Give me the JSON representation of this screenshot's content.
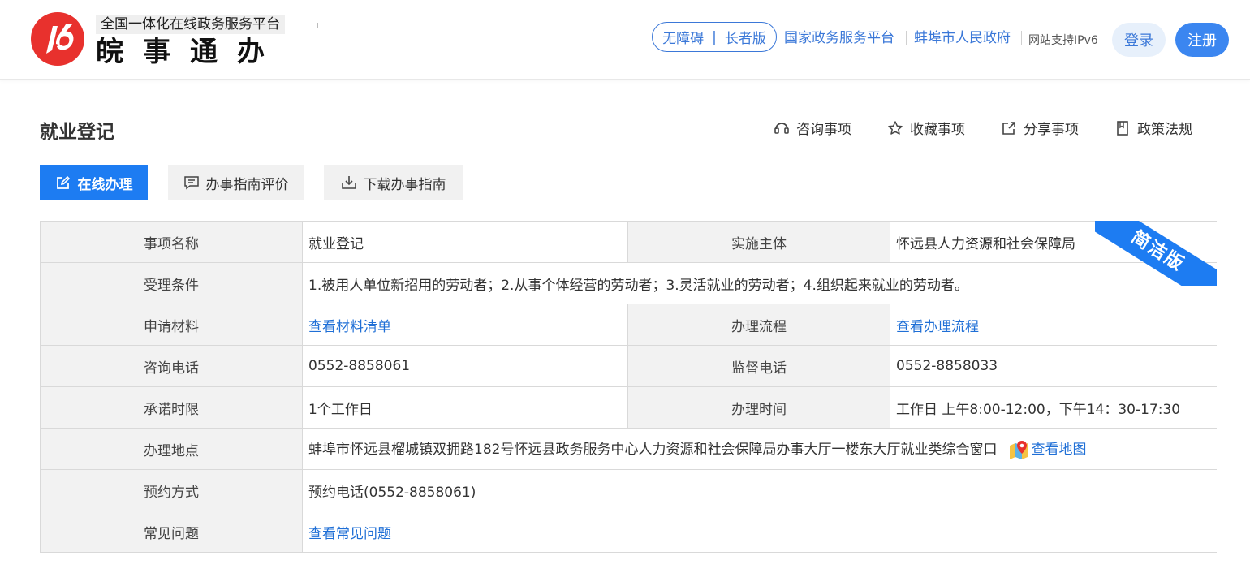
{
  "header": {
    "logo_sub": "全国一体化在线政务服务平台",
    "logo_main": "皖事通办",
    "accessibility": "无障碍",
    "elder": "长者版",
    "link_national": "国家政务服务平台",
    "link_city": "蚌埠市人民政府",
    "ipv6": "网站支持IPv6",
    "login": "登录",
    "register": "注册",
    "brand_color": "#e8312d",
    "accent_color": "#3b78d8"
  },
  "page": {
    "title": "就业登记",
    "actions": [
      {
        "label": "咨询事项",
        "icon": "consult-icon"
      },
      {
        "label": "收藏事项",
        "icon": "star-icon"
      },
      {
        "label": "分享事项",
        "icon": "share-icon"
      },
      {
        "label": "政策法规",
        "icon": "document-icon"
      }
    ],
    "buttons": {
      "online": "在线办理",
      "evaluate": "办事指南评价",
      "download": "下载办事指南"
    },
    "ribbon": "简洁版"
  },
  "table": {
    "item_name_label": "事项名称",
    "item_name": "就业登记",
    "subject_label": "实施主体",
    "subject": "怀远县人力资源和社会保障局",
    "condition_label": "受理条件",
    "condition": "1.被用人单位新招用的劳动者；2.从事个体经营的劳动者；3.灵活就业的劳动者；4.组织起来就业的劳动者。",
    "materials_label": "申请材料",
    "materials_link": "查看材料清单",
    "process_label": "办理流程",
    "process_link": "查看办理流程",
    "phone_label": "咨询电话",
    "phone": "0552-8858061",
    "supervise_label": "监督电话",
    "supervise": "0552-8858033",
    "limit_label": "承诺时限",
    "limit": "1个工作日",
    "hours_label": "办理时间",
    "hours": "工作日 上午8:00-12:00，下午14：30-17:30",
    "address_label": "办理地点",
    "address": "蚌埠市怀远县榴城镇双拥路182号怀远县政务服务中心人力资源和社会保障局办事大厅一楼东大厅就业类综合窗口",
    "map_link": "查看地图",
    "booking_label": "预约方式",
    "booking": "预约电话(0552-8858061)",
    "faq_label": "常见问题",
    "faq_link": "查看常见问题"
  }
}
